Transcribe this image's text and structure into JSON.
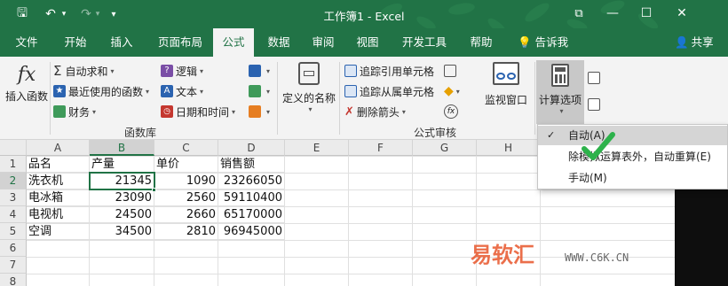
{
  "app": {
    "title": "工作簿1  -  Excel"
  },
  "qat": {
    "save": "🖫",
    "undo": "↶",
    "redo": "↷",
    "custom": "▾"
  },
  "window_buttons": {
    "restore": "⧉",
    "minimize": "—",
    "maximize": "☐",
    "close": "✕"
  },
  "tabs": [
    {
      "label": "文件"
    },
    {
      "label": "开始"
    },
    {
      "label": "插入"
    },
    {
      "label": "页面布局"
    },
    {
      "label": "公式",
      "active": true
    },
    {
      "label": "数据"
    },
    {
      "label": "审阅"
    },
    {
      "label": "视图"
    },
    {
      "label": "开发工具"
    },
    {
      "label": "帮助"
    }
  ],
  "tell_me": "告诉我",
  "share": "共享",
  "ribbon": {
    "insert_function": {
      "icon": "fx",
      "label": "插入函数"
    },
    "autosum": "自动求和",
    "recent": "最近使用的函数",
    "finance": "财务",
    "logic": "逻辑",
    "text": "文本",
    "datetime": "日期和时间",
    "defined_name": "定义的名称",
    "trace_precedents": "追踪引用单元格",
    "trace_dependents": "追踪从属单元格",
    "remove_arrows": "删除箭头",
    "watch_window": "监视窗口",
    "calc_options": "计算选项",
    "group_function_library": "函数库",
    "group_formula_auditing": "公式审核"
  },
  "calc_menu": {
    "items": [
      {
        "label": "自动(A)",
        "checked": true
      },
      {
        "label": "除模拟运算表外，自动重算(E)",
        "checked": false
      },
      {
        "label": "手动(M)",
        "checked": false
      }
    ]
  },
  "sheet": {
    "columns": [
      "A",
      "B",
      "C",
      "D",
      "E",
      "F",
      "G",
      "H"
    ],
    "rows": [
      "1",
      "2",
      "3",
      "4",
      "5",
      "6",
      "7",
      "8"
    ],
    "cells": [
      [
        "品名",
        "产量",
        "单价",
        "销售额"
      ],
      [
        "洗衣机",
        "21345",
        "1090",
        "23266050"
      ],
      [
        "电冰箱",
        "23090",
        "2560",
        "59110400"
      ],
      [
        "电视机",
        "24500",
        "2660",
        "65170000"
      ],
      [
        "空调",
        "34500",
        "2810",
        "96945000"
      ]
    ],
    "selected_column": "B",
    "selected_row": "2"
  },
  "watermark": {
    "brand": "易软汇",
    "url": "WWW.C6K.CN"
  },
  "colors": {
    "accent": "#217346",
    "check_green": "#2db24b",
    "watermark": "#e8572c"
  }
}
